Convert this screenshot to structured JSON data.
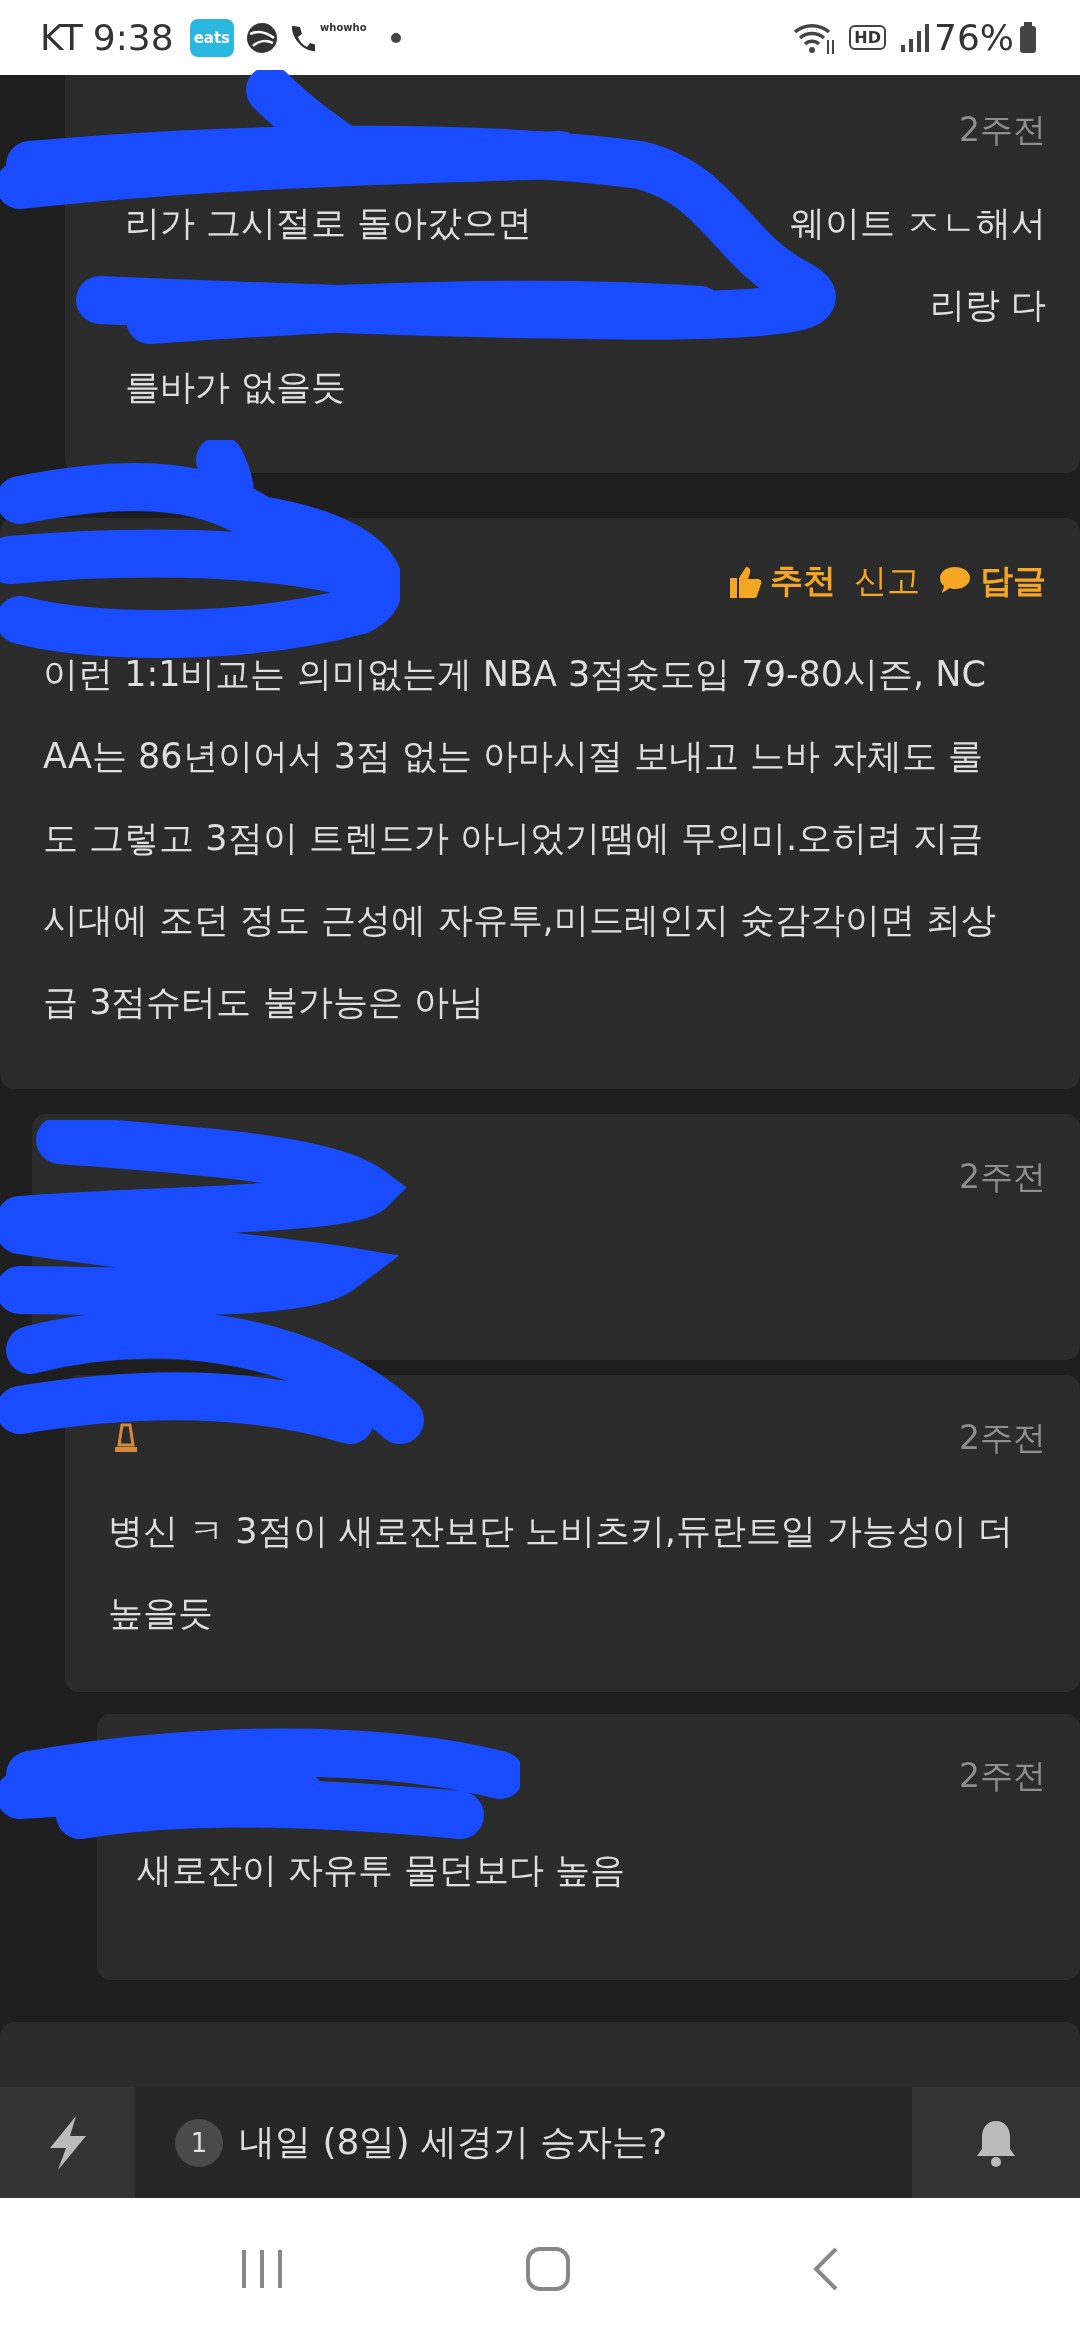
{
  "status_bar": {
    "carrier": "KT",
    "time": "9:38",
    "app_badge": "eats",
    "call_app_label": "whowho",
    "hd_label": "HD",
    "battery": "76%"
  },
  "comments": [
    {
      "kind": "cut",
      "time": "2주전",
      "lines": [
        {
          "left": "리가 그시절로 돌아갔으면",
          "right": "웨이트 ㅈㄴ해서"
        },
        {
          "right": "리랑 다"
        },
        {
          "left": "를바가 없을듯"
        }
      ]
    },
    {
      "kind": "full",
      "actions": [
        {
          "kind": "recommend",
          "label": "추천"
        },
        {
          "kind": "report",
          "label": "신고"
        },
        {
          "kind": "reply",
          "label": "답글"
        }
      ],
      "lines": [
        {
          "left": "이런 1:1비교는 의미없는게 NBA 3점슛도입 79-80시즌, NC"
        },
        {
          "left": "AA는 86년이어서 3점 없는 아마시절 보내고 느바 자체도 룰"
        },
        {
          "left": "도 그렇고 3점이 트렌드가 아니었기땜에 무의미.오히려 지금"
        },
        {
          "left": "시대에 조던 정도 근성에 자유투,미드레인지 슛감각이면 최상"
        },
        {
          "left": "급 3점슈터도 불가능은 아님"
        }
      ]
    },
    {
      "kind": "reply1",
      "time": "2주전"
    },
    {
      "kind": "reply2",
      "time": "2주전",
      "level_icon": true,
      "lines": [
        {
          "left": "병신 ㅋ 3점이 새로잔보단 노비츠키,듀란트일 가능성이 더"
        },
        {
          "left": "높을듯"
        }
      ]
    },
    {
      "kind": "reply3",
      "time": "2주전",
      "lines": [
        {
          "left": "새로잔이 자유투 물던보다 높음"
        }
      ]
    }
  ],
  "ticker": {
    "index": "1",
    "text": "내일 (8일) 세경기 승자는?"
  }
}
